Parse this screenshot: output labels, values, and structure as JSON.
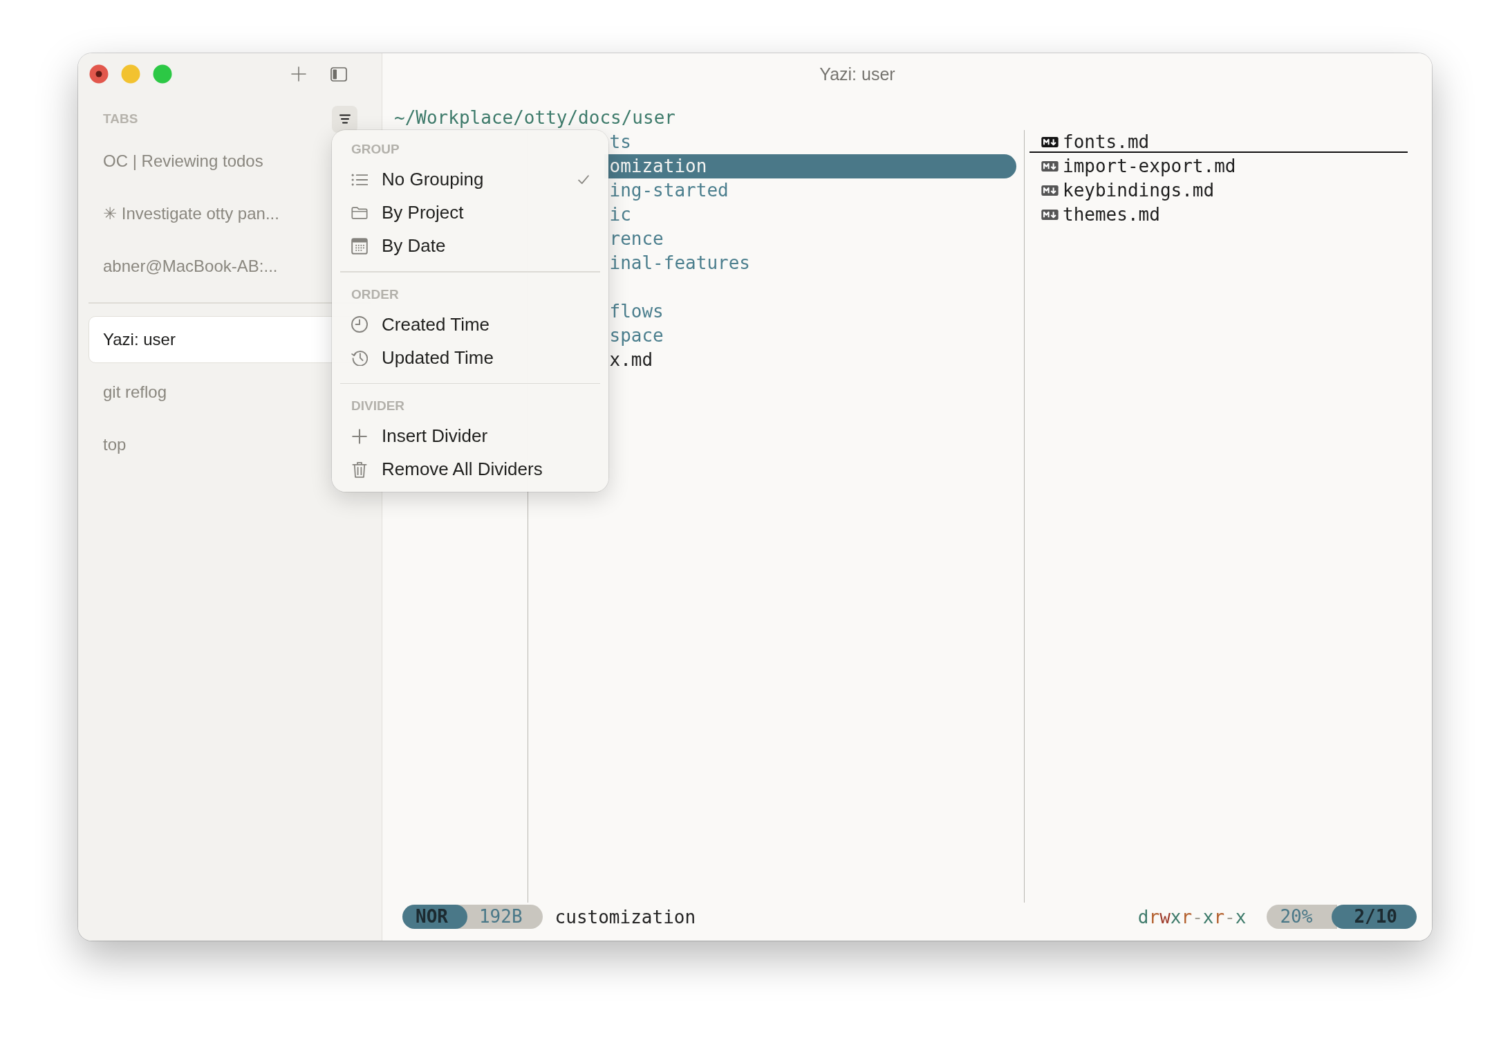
{
  "sidebar": {
    "header": "TABS",
    "filter_button": {
      "pressed": true
    },
    "tabs": [
      {
        "kind": "tab",
        "label": "OC | Reviewing todos",
        "selected": false
      },
      {
        "kind": "tab",
        "label": "✳ Investigate otty pan...",
        "selected": false
      },
      {
        "kind": "tab",
        "label": "abner@MacBook-AB:...",
        "selected": false
      },
      {
        "kind": "divider"
      },
      {
        "kind": "tab",
        "label": "Yazi: user",
        "selected": true
      },
      {
        "kind": "tab",
        "label": "git reflog",
        "selected": false
      },
      {
        "kind": "tab",
        "label": "top",
        "selected": false
      }
    ]
  },
  "terminal": {
    "title": "Yazi: user",
    "path": "~/Workplace/otty/docs/user",
    "current_dir": {
      "items": [
        {
          "kind": "dir",
          "name": "ts",
          "selected": false
        },
        {
          "kind": "dir",
          "name": "omization",
          "selected": true
        },
        {
          "kind": "dir",
          "name": "ing-started",
          "selected": false
        },
        {
          "kind": "dir",
          "name": "ic",
          "selected": false
        },
        {
          "kind": "dir",
          "name": "rence",
          "selected": false
        },
        {
          "kind": "dir",
          "name": "inal-features",
          "selected": false
        },
        {
          "kind": "dir",
          "selected": false
        },
        {
          "kind": "dir",
          "name": "flows",
          "selected": false
        },
        {
          "kind": "dir",
          "name": "space",
          "selected": false
        },
        {
          "kind": "file",
          "name": "x.md",
          "selected": false
        }
      ]
    },
    "preview": {
      "items": [
        {
          "name": "fonts.md",
          "selected": true
        },
        {
          "name": "import-export.md",
          "selected": false
        },
        {
          "name": "keybindings.md",
          "selected": false
        },
        {
          "name": "themes.md",
          "selected": false
        }
      ]
    },
    "status_bar": {
      "mode": "NOR",
      "size": "192B",
      "name": "customization",
      "permissions": [
        {
          "char": "d",
          "color": "#3e7b6b"
        },
        {
          "char": "r",
          "color": "#b35f2c"
        },
        {
          "char": "w",
          "color": "#9e3b2b"
        },
        {
          "char": "x",
          "color": "#3e7b6b"
        },
        {
          "char": "r",
          "color": "#b35f2c"
        },
        {
          "char": "-",
          "color": "#a39f95"
        },
        {
          "char": "x",
          "color": "#3e7b6b"
        },
        {
          "char": "r",
          "color": "#b35f2c"
        },
        {
          "char": "-",
          "color": "#a39f95"
        },
        {
          "char": "x",
          "color": "#3e7b6b"
        }
      ],
      "percent": "20%",
      "position": "2/10"
    }
  },
  "menu": {
    "sections": [
      {
        "title": "GROUP",
        "items": [
          {
            "label": "No Grouping",
            "checked": true
          },
          {
            "label": "By Project",
            "checked": false
          },
          {
            "label": "By Date",
            "checked": false
          }
        ]
      },
      {
        "title": "ORDER",
        "items": [
          {
            "label": "Created Time",
            "checked": false
          },
          {
            "label": "Updated Time",
            "checked": false
          }
        ]
      },
      {
        "title": "DIVIDER",
        "items": [
          {
            "label": "Insert Divider"
          },
          {
            "label": "Remove All Dividers"
          }
        ]
      }
    ]
  }
}
